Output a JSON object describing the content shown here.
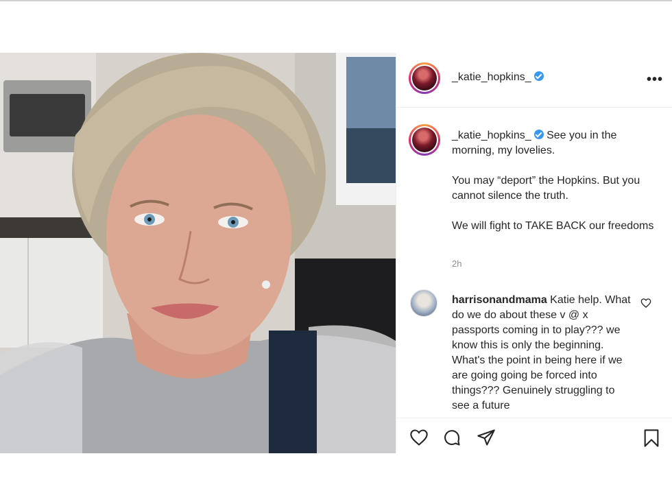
{
  "post": {
    "username": "_katie_hopkins_",
    "caption_paragraphs": [
      "See you in the morning, my lovelies.",
      "You may “deport” the Hopkins. But you cannot silence the truth.",
      "We will fight to TAKE BACK our freedoms"
    ],
    "time_ago": "2h"
  },
  "comment": {
    "username": "harrisonandmama",
    "text": "Katie help. What do we do about these v @ x passports coming in to play??? we know this is only the beginning. What's the point in being here if we are going going be forced into things??? Genuinely struggling to see a future"
  },
  "icons": {
    "more": "more-options-icon",
    "verified": "verified-badge-icon",
    "like": "heart-icon",
    "comment": "comment-icon",
    "share": "share-icon",
    "save": "bookmark-icon"
  },
  "colors": {
    "verified": "#3897f0",
    "text": "#262626",
    "muted": "#8e8e8e",
    "border": "#efefef"
  },
  "more_label": "•••"
}
